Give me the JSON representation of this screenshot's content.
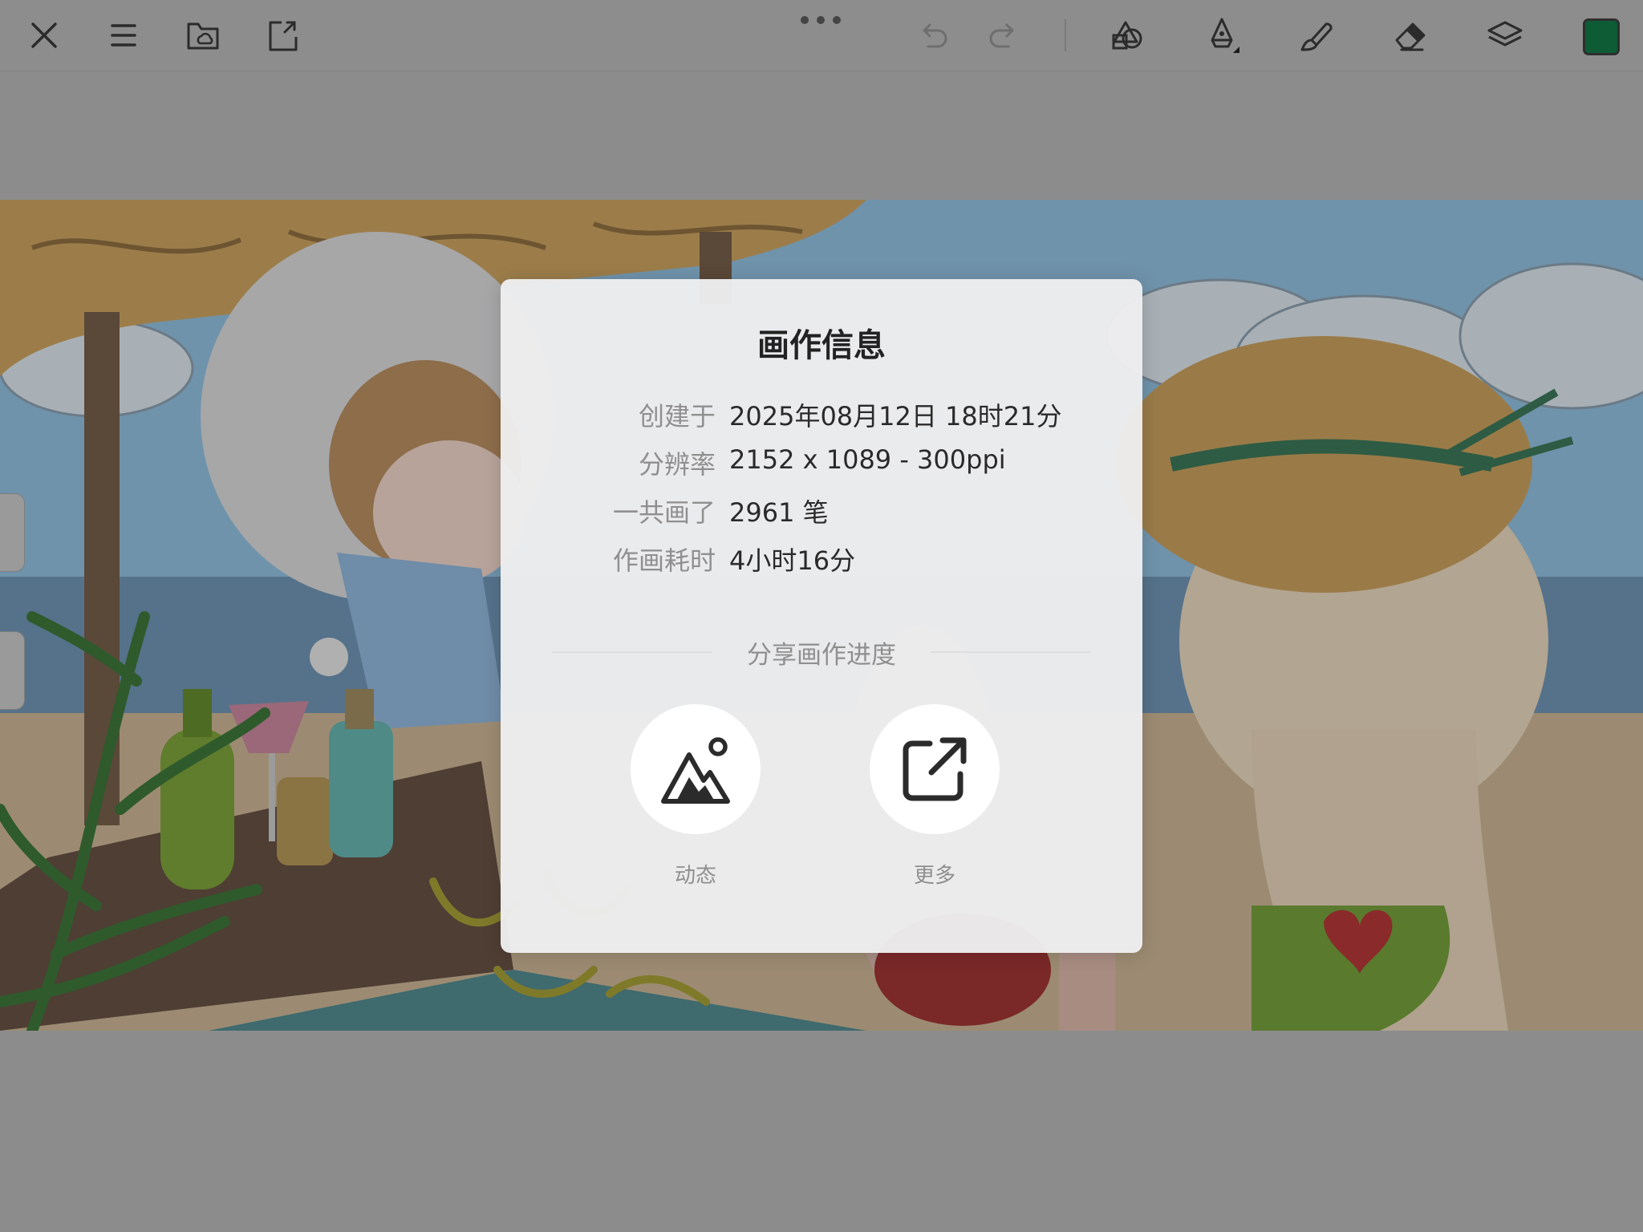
{
  "toolbar": {
    "icons": [
      "close-icon",
      "menu-icon",
      "folder-cloud-icon",
      "export-icon",
      "more-dots-icon",
      "undo-icon",
      "redo-icon",
      "shapes-icon",
      "pen-icon",
      "brush-icon",
      "eraser-icon",
      "layers-icon"
    ],
    "current_color": "#0d5c36"
  },
  "dialog": {
    "title": "画作信息",
    "rows": [
      {
        "label": "创建于",
        "value": "2025年08月12日 18时21分"
      },
      {
        "label": "分辨率",
        "value": "2152 x 1089 - 300ppi"
      },
      {
        "label": "一共画了",
        "value": "2961 笔"
      },
      {
        "label": "作画耗时",
        "value": "4小时16分"
      }
    ],
    "share": {
      "title": "分享画作进度",
      "buttons": [
        {
          "label": "动态",
          "icon": "mountain-image-icon"
        },
        {
          "label": "更多",
          "icon": "external-share-icon"
        }
      ]
    }
  }
}
